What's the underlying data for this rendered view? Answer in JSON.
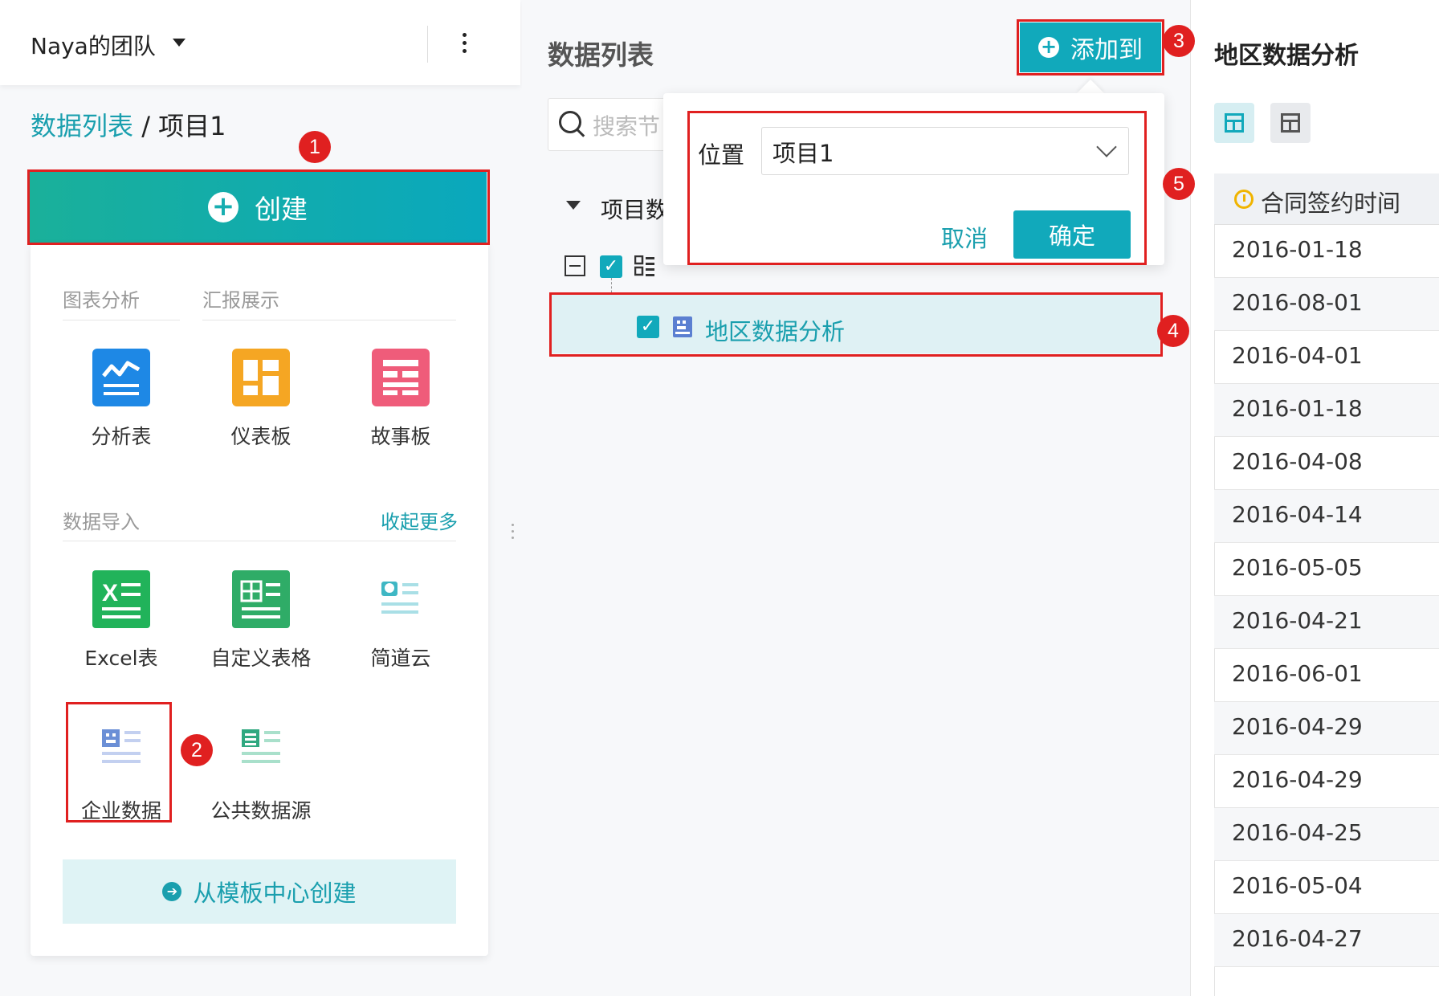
{
  "header": {
    "team_name": "Naya的团队"
  },
  "breadcrumb": {
    "root": "数据列表",
    "separator": " / ",
    "current": "项目1"
  },
  "create_button": {
    "label": "创建"
  },
  "menu": {
    "section_analysis": "图表分析",
    "section_report": "汇报展示",
    "analysis_items": [
      {
        "label": "分析表",
        "icon": "analysis-table-icon",
        "color": "#1e88e5"
      },
      {
        "label": "仪表板",
        "icon": "dashboard-icon",
        "color": "#f5a623"
      },
      {
        "label": "故事板",
        "icon": "storyboard-icon",
        "color": "#ef5c7a"
      }
    ],
    "section_import": "数据导入",
    "collapse_more": "收起更多",
    "import_items": [
      {
        "label": "Excel表",
        "icon": "excel-icon",
        "color": "#21b35a"
      },
      {
        "label": "自定义表格",
        "icon": "custom-table-icon",
        "color": "#2fac67"
      },
      {
        "label": "简道云",
        "icon": "jiandaoyun-icon",
        "color": "#3fb7c4"
      },
      {
        "label": "企业数据",
        "icon": "enterprise-data-icon",
        "color": "#6b8fd6"
      },
      {
        "label": "公共数据源",
        "icon": "public-datasource-icon",
        "color": "#2fa880"
      }
    ],
    "template_button": "从模板中心创建"
  },
  "middle": {
    "title": "数据列表",
    "search_placeholder": "搜索节",
    "tree_project_label": "项目数",
    "tree_selected_item": "地区数据分析"
  },
  "add_to": {
    "button_label": "添加到",
    "position_label": "位置",
    "position_value": "项目1",
    "cancel_label": "取消",
    "confirm_label": "确定"
  },
  "right": {
    "title": "地区数据分析",
    "column_header": "合同签约时间",
    "dates": [
      "2016-01-18",
      "2016-08-01",
      "2016-04-01",
      "2016-01-18",
      "2016-04-08",
      "2016-04-14",
      "2016-05-05",
      "2016-04-21",
      "2016-06-01",
      "2016-04-29",
      "2016-04-29",
      "2016-04-25",
      "2016-05-04",
      "2016-04-27"
    ]
  },
  "annotations": [
    "1",
    "2",
    "3",
    "4",
    "5"
  ],
  "colors": {
    "accent": "#11a9bb",
    "highlight": "#e02020"
  }
}
